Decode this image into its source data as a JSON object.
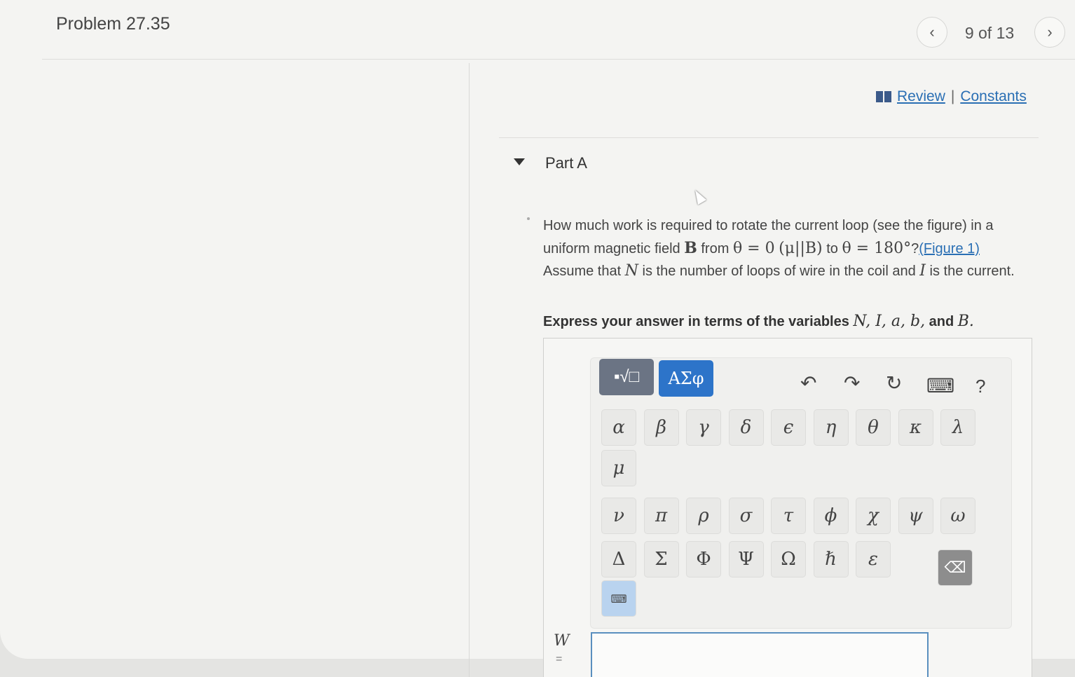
{
  "header": {
    "title": "Problem 27.35",
    "page_count": "9 of 13",
    "prev_icon": "‹",
    "next_icon": "›"
  },
  "links": {
    "review": "Review",
    "separator": "|",
    "constants": "Constants"
  },
  "part": {
    "title": "Part A",
    "q1": "How much work is required to rotate the current loop (see the figure) in a uniform magnetic field ",
    "q_B": "B",
    "q2": " from ",
    "q_theta0": "θ = 0",
    "q_paren": "(μ||B)",
    "q3": " to ",
    "q_theta180": "θ = 180°",
    "q4": "?",
    "figure_link": "(Figure 1)",
    "q5": " Assume that ",
    "q_N": "N",
    "q6": " is the number of loops of wire in the coil and ",
    "q_I": "I",
    "q7": " is the current.",
    "express_prefix": "Express your answer in terms of the variables ",
    "express_vars": "N, I, a, b,",
    "express_and": " and ",
    "express_last": "B."
  },
  "toolbar": {
    "template_label": "▪√□",
    "greek_label": "ΑΣφ",
    "undo": "↶",
    "redo": "↷",
    "reset": "↻",
    "keyboard": "⌨",
    "help": "?"
  },
  "keys": {
    "row1": [
      "α",
      "β",
      "γ",
      "δ",
      "ϵ",
      "η",
      "θ",
      "κ",
      "λ"
    ],
    "row2": [
      "μ"
    ],
    "row3": [
      "ν",
      "π",
      "ρ",
      "σ",
      "τ",
      "ϕ",
      "χ",
      "ψ",
      "ω"
    ],
    "row4": [
      "Δ",
      "Σ",
      "Φ",
      "Ψ",
      "Ω",
      "ℏ",
      "ε"
    ],
    "backspace": "⌫",
    "keyboard_toggle": "⌨"
  },
  "answer": {
    "label": "W",
    "equals": "="
  }
}
